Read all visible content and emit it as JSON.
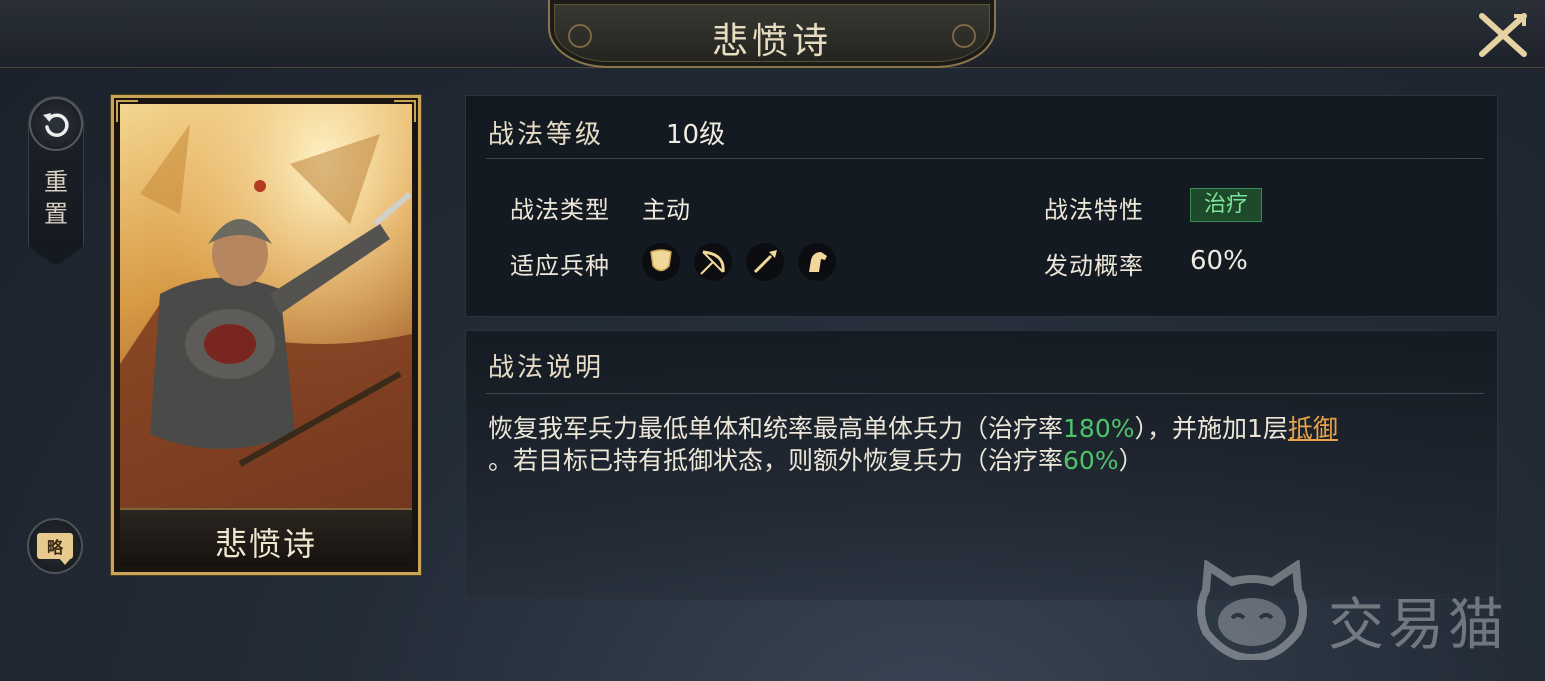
{
  "header": {
    "title": "悲愤诗"
  },
  "sidebar": {
    "reset_label": "重置",
    "brief_label": "略"
  },
  "card": {
    "name": "悲愤诗"
  },
  "info": {
    "level_label": "战法等级",
    "level_value": "10级",
    "type_label": "战法类型",
    "type_value": "主动",
    "trait_label": "战法特性",
    "trait_value": "治疗",
    "unit_label": "适应兵种",
    "rate_label": "发动概率",
    "rate_value": "60%",
    "unit_icons": [
      "shield-icon",
      "bow-icon",
      "spear-icon",
      "horse-icon"
    ]
  },
  "description": {
    "header": "战法说明",
    "part1": "恢复我军兵力最低单体和统率最高单体兵力（治疗率",
    "val1": "180%",
    "part2": "），并施加1层",
    "link": "抵御",
    "part3": "。若目标已持有抵御状态，则额外恢复兵力（治疗率",
    "val2": "60%",
    "part4": "）"
  },
  "watermark": {
    "text": "交易猫"
  },
  "colors": {
    "accent_gold": "#c9a456",
    "heal_green": "#4fc26c",
    "link_orange": "#e7a24b"
  }
}
